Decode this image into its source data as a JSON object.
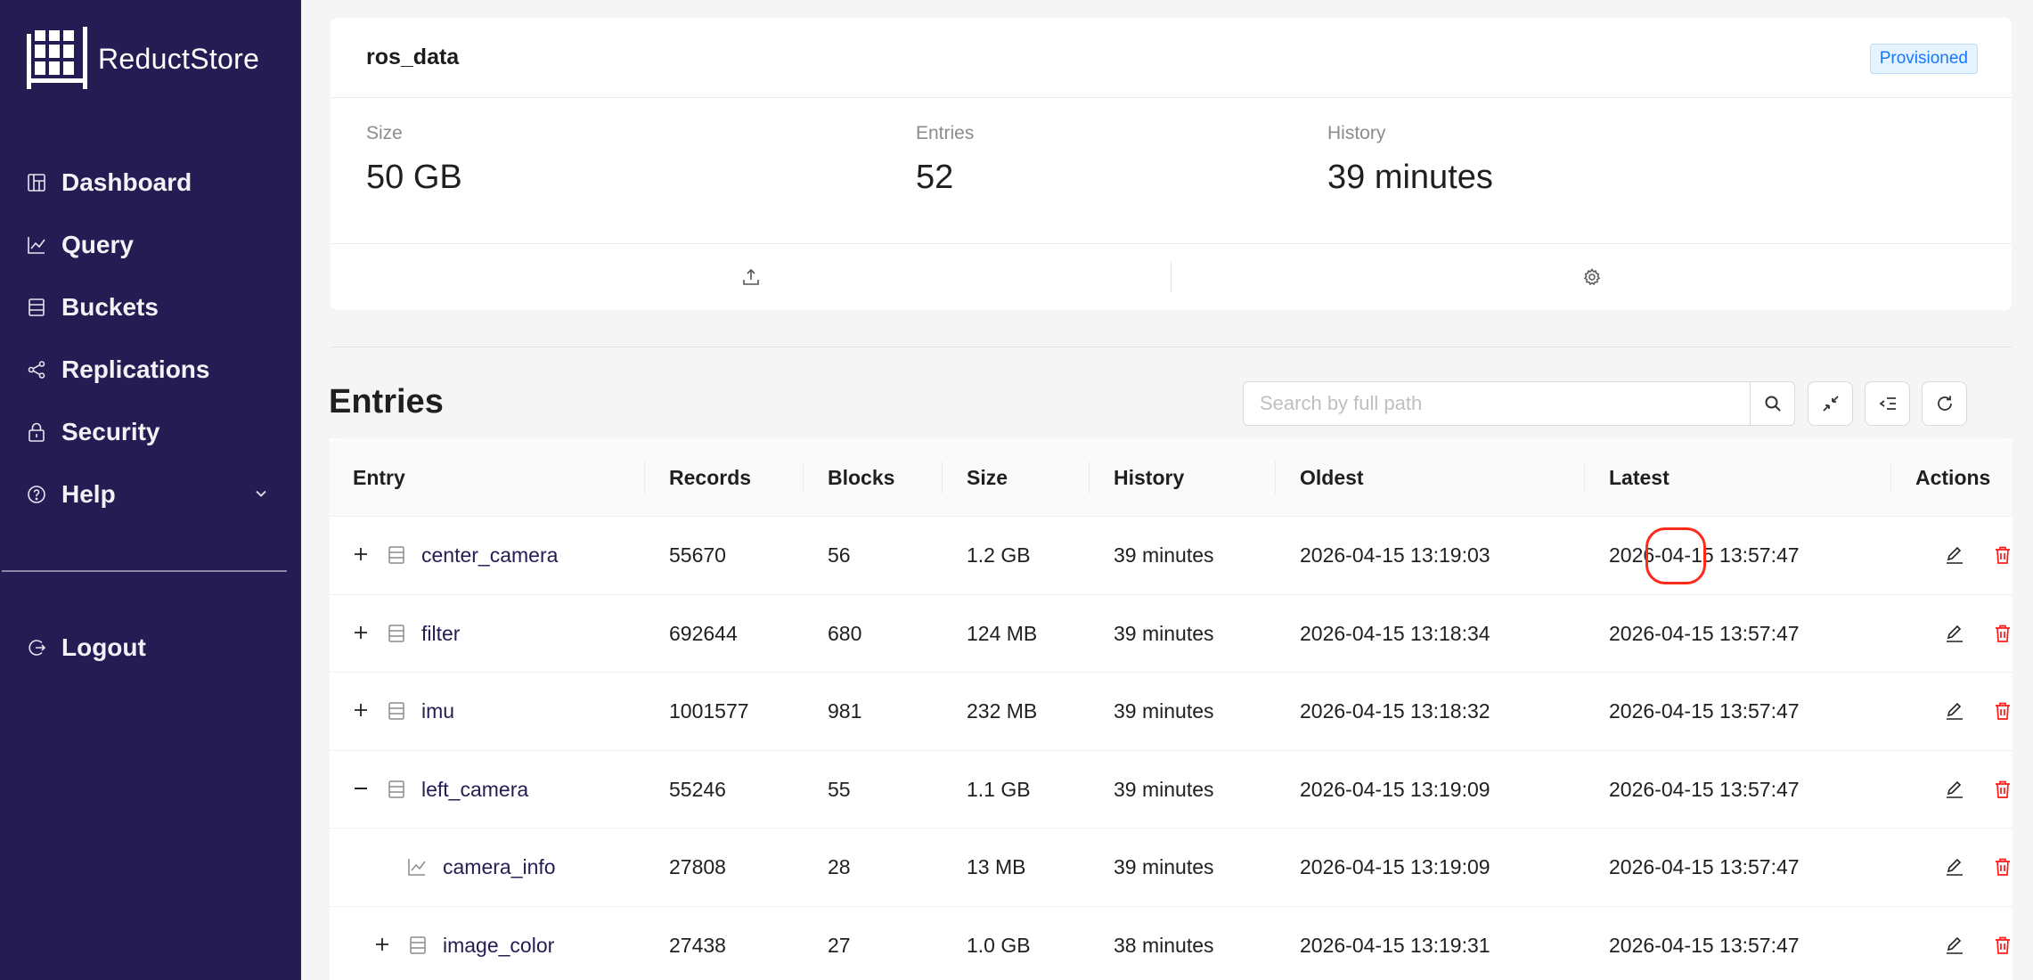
{
  "app": {
    "name": "ReductStore"
  },
  "sidebar": {
    "items": [
      {
        "label": "Dashboard",
        "icon": "dashboard-icon"
      },
      {
        "label": "Query",
        "icon": "line-chart-icon"
      },
      {
        "label": "Buckets",
        "icon": "database-icon"
      },
      {
        "label": "Replications",
        "icon": "share-icon"
      },
      {
        "label": "Security",
        "icon": "lock-icon"
      },
      {
        "label": "Help",
        "icon": "question-circle-icon"
      }
    ],
    "logout": {
      "label": "Logout",
      "icon": "logout-icon"
    }
  },
  "bucket": {
    "name": "ros_data",
    "badge": "Provisioned",
    "stats": {
      "size": {
        "label": "Size",
        "value": "50 GB"
      },
      "entries": {
        "label": "Entries",
        "value": "52"
      },
      "history": {
        "label": "History",
        "value": "39 minutes"
      }
    }
  },
  "entries": {
    "title": "Entries",
    "search": {
      "placeholder": "Search by full path",
      "value": ""
    },
    "columns": [
      "Entry",
      "Records",
      "Blocks",
      "Size",
      "History",
      "Oldest",
      "Latest",
      "Actions"
    ],
    "rows": [
      {
        "name": "center_camera",
        "expander": "plus",
        "icon": "database-icon",
        "level": 0,
        "records": "55670",
        "blocks": "56",
        "size": "1.2 GB",
        "history": "39 minutes",
        "oldest": "2026-04-15 13:19:03",
        "latest": "2026-04-15 13:57:47"
      },
      {
        "name": "filter",
        "expander": "plus",
        "icon": "database-icon",
        "level": 0,
        "records": "692644",
        "blocks": "680",
        "size": "124 MB",
        "history": "39 minutes",
        "oldest": "2026-04-15 13:18:34",
        "latest": "2026-04-15 13:57:47"
      },
      {
        "name": "imu",
        "expander": "plus",
        "icon": "database-icon",
        "level": 0,
        "records": "1001577",
        "blocks": "981",
        "size": "232 MB",
        "history": "39 minutes",
        "oldest": "2026-04-15 13:18:32",
        "latest": "2026-04-15 13:57:47"
      },
      {
        "name": "left_camera",
        "expander": "minus",
        "icon": "database-icon",
        "level": 0,
        "records": "55246",
        "blocks": "55",
        "size": "1.1 GB",
        "history": "39 minutes",
        "oldest": "2026-04-15 13:19:09",
        "latest": "2026-04-15 13:57:47"
      },
      {
        "name": "camera_info",
        "expander": "none",
        "icon": "line-chart-icon",
        "level": 1,
        "records": "27808",
        "blocks": "28",
        "size": "13 MB",
        "history": "39 minutes",
        "oldest": "2026-04-15 13:19:09",
        "latest": "2026-04-15 13:57:47"
      },
      {
        "name": "image_color",
        "expander": "plus",
        "icon": "database-icon",
        "level": 1,
        "records": "27438",
        "blocks": "27",
        "size": "1.0 GB",
        "history": "38 minutes",
        "oldest": "2026-04-15 13:19:31",
        "latest": "2026-04-15 13:57:47"
      }
    ]
  },
  "colors": {
    "sidebar": "#241c53",
    "danger": "#ff1a1a",
    "highlight": "#ff2a1a",
    "link": "#241c53"
  }
}
